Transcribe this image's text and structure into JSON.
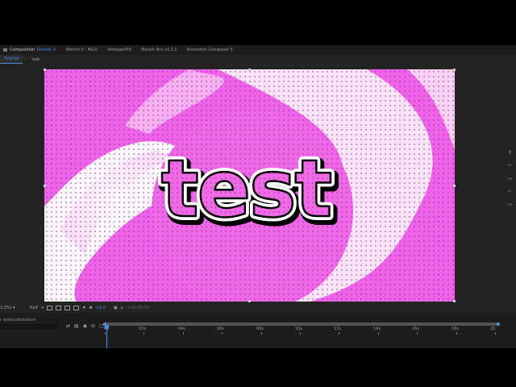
{
  "tabs": {
    "composition": {
      "prefix": "Composition",
      "name": "Tutorial"
    },
    "panels": [
      "Motion 3 - MG©",
      "Notepad®5",
      "Motion Bro v3.2.1",
      "Animation Composer 3"
    ]
  },
  "sub_tabs": [
    "Tutorial",
    "text"
  ],
  "canvas": {
    "text": "test"
  },
  "viewer_controls": {
    "zoom": "3,3%)",
    "resolution": "Half",
    "exposure": "+0,0",
    "timecode": "0;00;00;00"
  },
  "timeline": {
    "layer_name": "r aowkaokdoakoo",
    "ticks": [
      "0s",
      "02s",
      "04s",
      "06s",
      "08s",
      "10s",
      "12s",
      "14s",
      "16s",
      "18s",
      "20"
    ],
    "time_start": 0,
    "time_end": 20,
    "playhead_time": 0
  },
  "colors": {
    "accent": "#4a90e2",
    "magenta": "#ef63ea",
    "light_pink": "#f8d8f5",
    "text_fill": "#f06ae8"
  }
}
